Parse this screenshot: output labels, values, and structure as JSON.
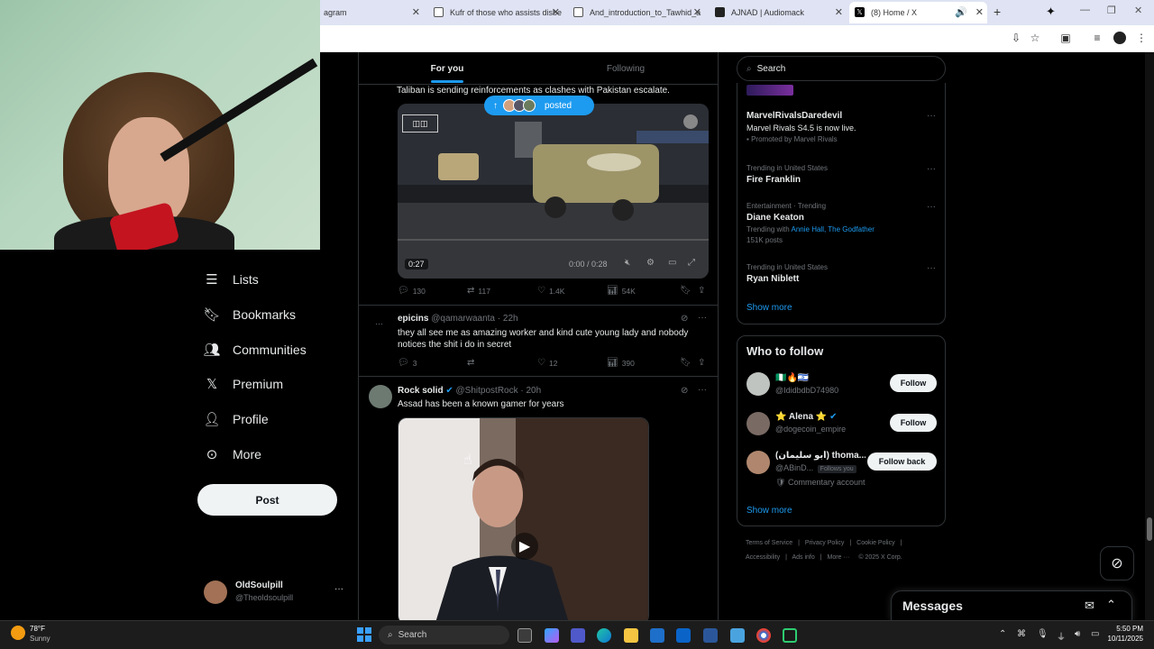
{
  "browser": {
    "tabs": [
      {
        "title": "agram",
        "color": "#c13584"
      },
      {
        "title": "Kufr of those who assists disbe",
        "color": "#555555"
      },
      {
        "title": "And_introduction_to_Tawhid_a",
        "color": "#555555"
      },
      {
        "title": "AJNAD | Audiomack",
        "color": "#222222"
      },
      {
        "title": "(8) Home / X",
        "color": "#000000"
      }
    ]
  },
  "nav": {
    "items": [
      {
        "label": "Lists",
        "icon": "list-icon"
      },
      {
        "label": "Bookmarks",
        "icon": "bookmark-icon"
      },
      {
        "label": "Communities",
        "icon": "communities-icon"
      },
      {
        "label": "Premium",
        "icon": "x-logo-icon"
      },
      {
        "label": "Profile",
        "icon": "person-icon"
      },
      {
        "label": "More",
        "icon": "more-circle-icon"
      }
    ],
    "post_label": "Post",
    "profile": {
      "name": "OldSoulpill",
      "handle": "@Theoldsoulpill"
    }
  },
  "feed": {
    "tabs": {
      "for_you": "For you",
      "following": "Following"
    },
    "posted_pill": "posted",
    "post1": {
      "text": "Taliban is sending reinforcements as clashes with Pakistan escalate.",
      "video_badge": "0:27",
      "video_time": "0:00 / 0:28",
      "replies": "130",
      "reposts": "117",
      "likes": "1.4K",
      "views": "54K"
    },
    "post2": {
      "name": "epicins",
      "handle": "@qamarwaanta",
      "time": "· 22h",
      "text": "they all see me as amazing worker and kind cute young lady and nobody notices the shit i do in secret",
      "replies": "3",
      "reposts": "",
      "likes": "12",
      "views": "390"
    },
    "post3": {
      "name": "Rock solid",
      "handle": "@ShitpostRock",
      "time": "· 20h",
      "text": "Assad has been a known gamer for years"
    }
  },
  "right": {
    "search_placeholder": "Search",
    "trends": [
      {
        "meta": "",
        "title": "MarvelRivalsDaredevil",
        "sub": "Marvel Rivals S4.5 is now live.",
        "extra": "Promoted by Marvel Rivals"
      },
      {
        "meta": "Trending in United States",
        "title": "Fire Franklin"
      },
      {
        "meta": "Entertainment · Trending",
        "title": "Diane Keaton",
        "trending_with": "Trending with",
        "with_links": "Annie Hall, The Godfather",
        "posts": "151K posts"
      },
      {
        "meta": "Trending in United States",
        "title": "Ryan Niblett"
      }
    ],
    "show_more": "Show more",
    "who_to_follow_title": "Who to follow",
    "who": [
      {
        "name": "🇳🇬🔥🇮🇱",
        "handle": "@IdidbdbD74980",
        "button": "Follow"
      },
      {
        "name": "⭐ Alena ⭐",
        "handle": "@dogecoin_empire",
        "button": "Follow"
      },
      {
        "name": "(أبو سليمان) thoma...",
        "handle": "@ABinD...",
        "follows_you": "Follows you",
        "note": "Commentary account",
        "button": "Follow back"
      }
    ],
    "who_show_more": "Show more",
    "footer": {
      "row1": [
        "Terms of Service",
        "Privacy Policy",
        "Cookie Policy"
      ],
      "row2": [
        "Accessibility",
        "Ads info",
        "More ···",
        "© 2025 X Corp."
      ]
    },
    "messages_label": "Messages"
  },
  "taskbar": {
    "weather_temp": "78°F",
    "weather_desc": "Sunny",
    "search_label": "Search",
    "time": "5:50 PM",
    "date": "10/11/2025"
  },
  "colors": {
    "accent": "#1d9bf0",
    "background": "#000000",
    "text": "#e7e9ea",
    "muted": "#71767b"
  }
}
